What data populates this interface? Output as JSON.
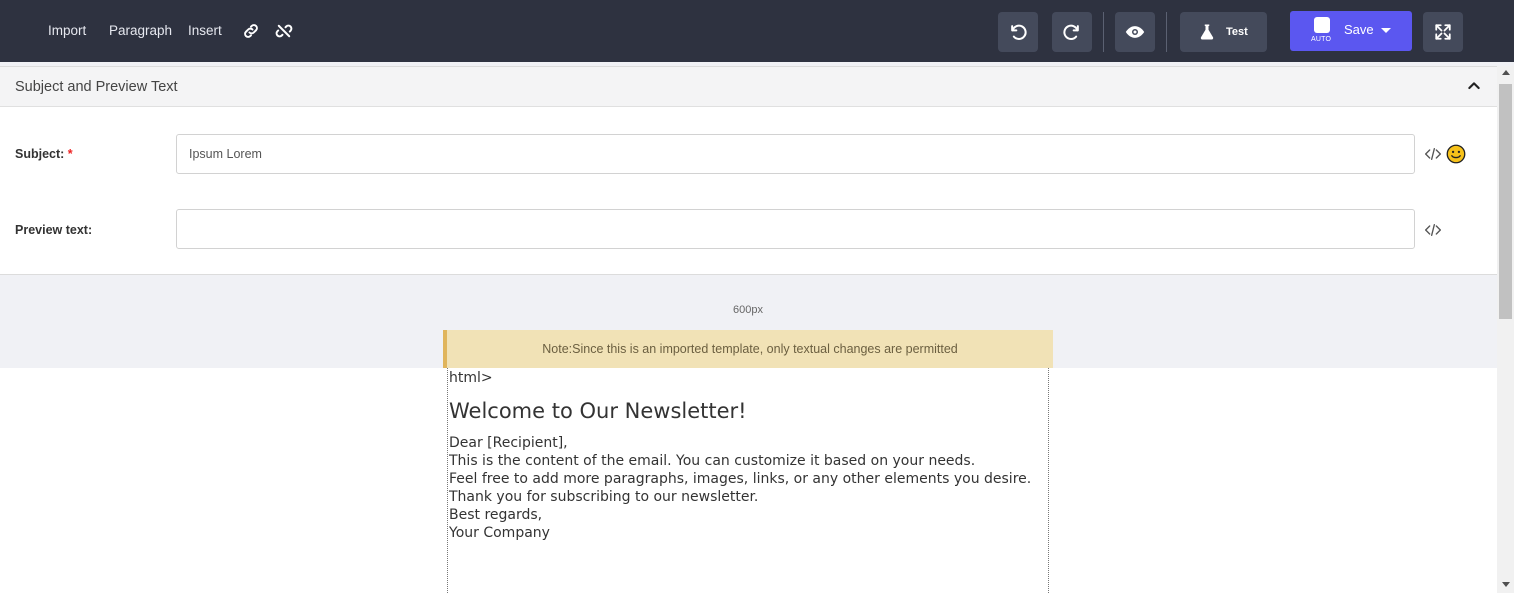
{
  "toolbar": {
    "menu": [
      "Import",
      "Paragraph",
      "Insert"
    ],
    "test_label": "Test",
    "save_label": "Save",
    "save_auto": "AUTO",
    "icons": [
      "link-icon",
      "unlink-icon",
      "undo-icon",
      "redo-icon",
      "eye-icon",
      "flask-icon",
      "fullscreen-icon"
    ]
  },
  "panel": {
    "title": "Subject and Preview Text",
    "subject_label": "Subject:",
    "required_mark": "*",
    "subject_value": "Ipsum Lorem",
    "preview_label": "Preview text:",
    "preview_value": ""
  },
  "canvas": {
    "width_label": "600px",
    "note": "Note:Since this is an imported template, only textual changes are permitted"
  },
  "email": {
    "tag": "html>",
    "heading": "Welcome to Our Newsletter!",
    "lines": [
      "Dear [Recipient],",
      "This is the content of the email. You can customize it based on your needs.",
      "Feel free to add more paragraphs, images, links, or any other elements you desire.",
      "Thank you for subscribing to our newsletter.",
      "Best regards,",
      "Your Company"
    ]
  },
  "colors": {
    "toolbar_bg": "#2e3240",
    "save_button": "#5b57f0",
    "note_bg": "#f1e2b6",
    "required": "#ee2222"
  }
}
